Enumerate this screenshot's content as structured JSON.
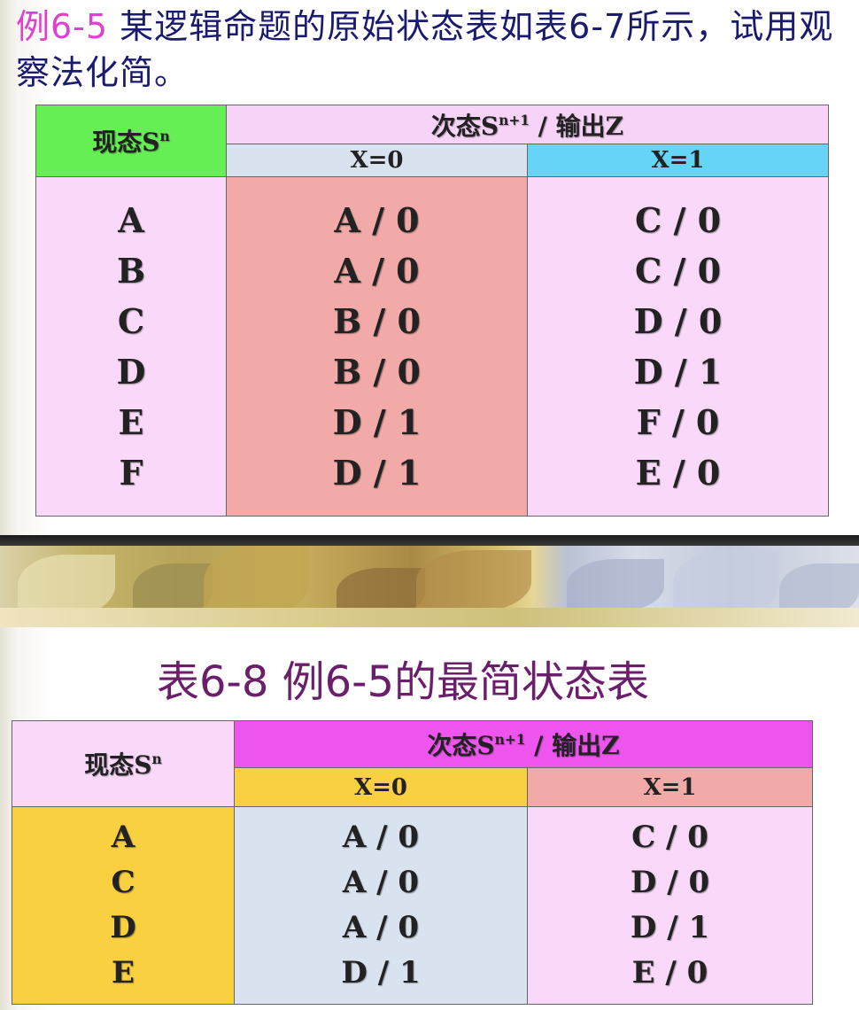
{
  "heading1": {
    "example": "例6-5",
    "text": " 某逻辑命题的原始状态表如表6-7所示，试用观察法化简。"
  },
  "table1": {
    "present_label": "现态S",
    "present_sup": "n",
    "next_label": "次态S",
    "next_sup": "n+1",
    "next_suffix": " / 输出Z",
    "x0_label": "X=0",
    "x1_label": "X=1",
    "rows": [
      {
        "state": "A",
        "x0": "A / 0",
        "x1": "C / 0"
      },
      {
        "state": "B",
        "x0": "A / 0",
        "x1": "C / 0"
      },
      {
        "state": "C",
        "x0": "B / 0",
        "x1": "D / 0"
      },
      {
        "state": "D",
        "x0": "B / 0",
        "x1": "D / 1"
      },
      {
        "state": "E",
        "x0": "D / 1",
        "x1": "F / 0"
      },
      {
        "state": "F",
        "x0": "D / 1",
        "x1": "E / 0"
      }
    ],
    "colors": {
      "present_header": "#66ee55",
      "next_header": "#f7d3f7",
      "x0_header": "#d9e3ef",
      "x1_header": "#66d4f7",
      "present_body": "#f9d8f9",
      "x0_body": "#f2aaa8",
      "x1_body": "#f9d8f9"
    }
  },
  "heading2": "表6-8  例6-5的最简状态表",
  "table2": {
    "present_label": "现态S",
    "present_sup": "n",
    "next_label": "次态S",
    "next_sup": "n+1",
    "next_suffix": " / 输出Z",
    "x0_label": "X=0",
    "x1_label": "X=1",
    "rows": [
      {
        "state": "A",
        "x0": "A / 0",
        "x1": "C / 0"
      },
      {
        "state": "C",
        "x0": "A / 0",
        "x1": "D / 0"
      },
      {
        "state": "D",
        "x0": "A / 0",
        "x1": "D / 1"
      },
      {
        "state": "E",
        "x0": "D / 1",
        "x1": "E / 0"
      }
    ],
    "colors": {
      "present_header": "#f9d8f9",
      "next_header": "#ee55ee",
      "x0_header": "#f9d040",
      "x1_header": "#f2aaa8",
      "present_body": "#f9d040",
      "x0_body": "#d9e3ef",
      "x1_body": "#f9d8f9"
    }
  }
}
